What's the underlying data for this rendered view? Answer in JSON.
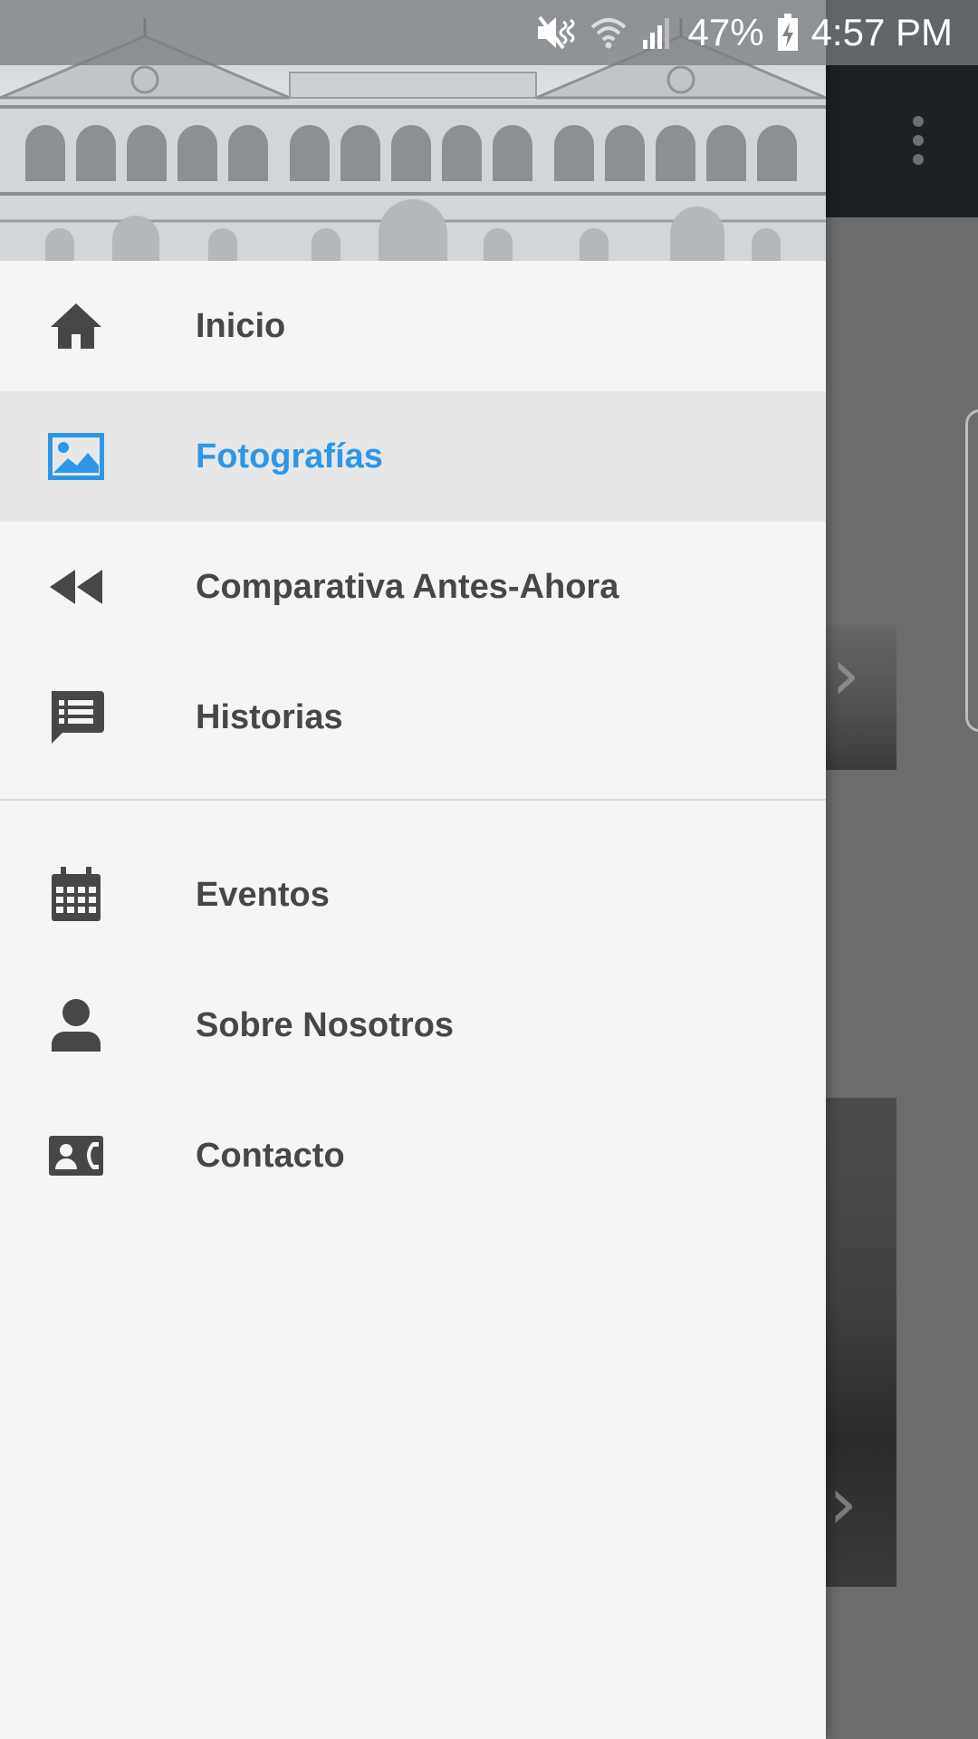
{
  "status_bar": {
    "battery": "47%",
    "time": "4:57 PM",
    "icons": [
      "mute-icon",
      "wifi-icon",
      "signal-icon",
      "battery-charging-icon"
    ]
  },
  "app": {
    "overflow_icon": "more-vert-icon"
  },
  "drawer": {
    "primary_items": [
      {
        "label": "Inicio",
        "icon": "home-icon",
        "active": false
      },
      {
        "label": "Fotografías",
        "icon": "image-icon",
        "active": true
      },
      {
        "label": "Comparativa Antes-Ahora",
        "icon": "rewind-icon",
        "active": false
      },
      {
        "label": "Historias",
        "icon": "message-list-icon",
        "active": false
      }
    ],
    "secondary_items": [
      {
        "label": "Eventos",
        "icon": "calendar-icon",
        "active": false
      },
      {
        "label": "Sobre Nosotros",
        "icon": "person-icon",
        "active": false
      },
      {
        "label": "Contacto",
        "icon": "contact-card-icon",
        "active": false
      }
    ]
  },
  "colors": {
    "accent": "#2c97e8",
    "drawer_bg": "#f5f5f5",
    "active_bg": "#e7e7e7",
    "text": "#474747",
    "toolbar": "#1d2124"
  }
}
